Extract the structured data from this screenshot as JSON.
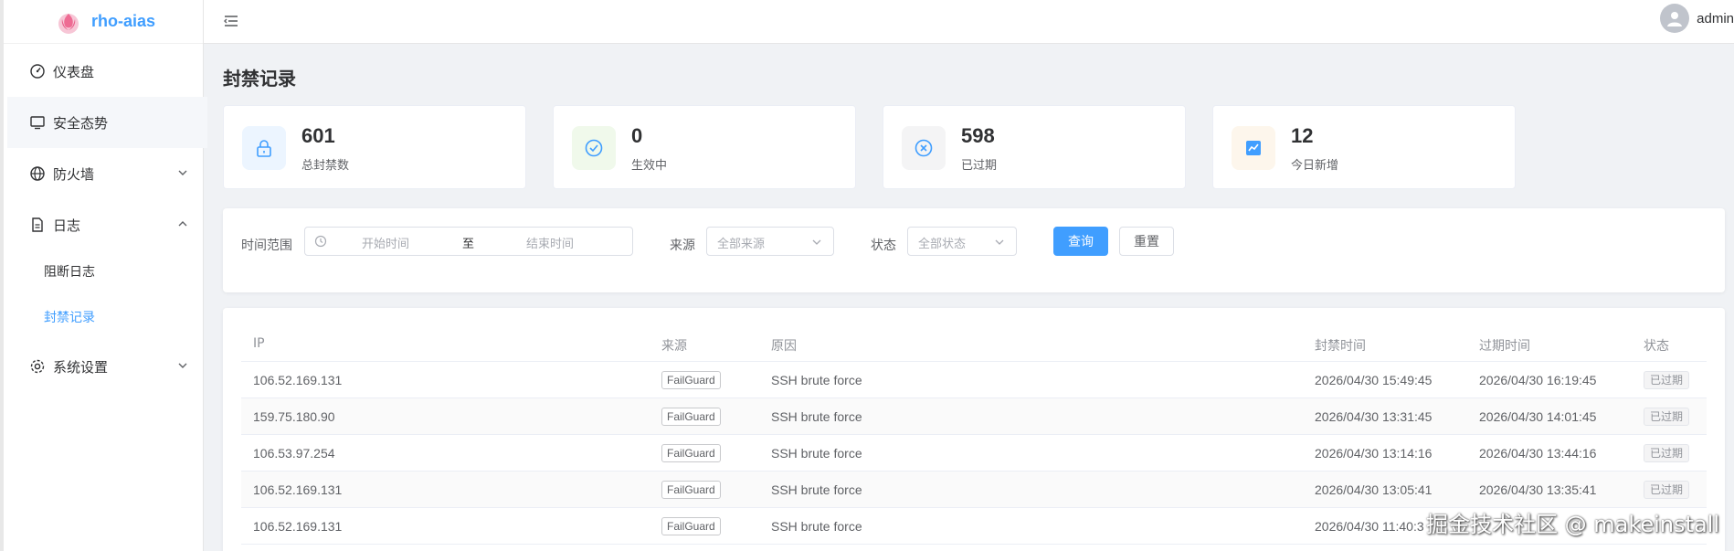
{
  "app": {
    "brand": "rho-aias"
  },
  "header": {
    "username": "admin"
  },
  "sidebar": {
    "items": [
      {
        "label": "仪表盘"
      },
      {
        "label": "安全态势"
      },
      {
        "label": "防火墙"
      },
      {
        "label": "日志",
        "children": [
          {
            "label": "阻断日志"
          },
          {
            "label": "封禁记录"
          }
        ]
      },
      {
        "label": "系统设置"
      }
    ]
  },
  "page": {
    "title": "封禁记录"
  },
  "stats": [
    {
      "value": "601",
      "label": "总封禁数",
      "icon": "lock-icon",
      "color": "#409eff"
    },
    {
      "value": "0",
      "label": "生效中",
      "icon": "check-circle-icon",
      "color": "#67c23a"
    },
    {
      "value": "598",
      "label": "已过期",
      "icon": "x-circle-icon",
      "color": "#409eff"
    },
    {
      "value": "12",
      "label": "今日新增",
      "icon": "trend-icon",
      "color": "#409eff"
    }
  ],
  "filters": {
    "time_label": "时间范围",
    "start_placeholder": "开始时间",
    "range_sep": "至",
    "end_placeholder": "结束时间",
    "source_label": "来源",
    "source_placeholder": "全部来源",
    "status_label": "状态",
    "status_placeholder": "全部状态",
    "query_button": "查询",
    "reset_button": "重置"
  },
  "table": {
    "columns": [
      "IP",
      "来源",
      "原因",
      "封禁时间",
      "过期时间",
      "状态"
    ],
    "rows": [
      {
        "ip": "106.52.169.131",
        "source": "FailGuard",
        "reason": "SSH brute force",
        "ban_time": "2026/04/30 15:49:45",
        "expire_time": "2026/04/30 16:19:45",
        "status": "已过期"
      },
      {
        "ip": "159.75.180.90",
        "source": "FailGuard",
        "reason": "SSH brute force",
        "ban_time": "2026/04/30 13:31:45",
        "expire_time": "2026/04/30 14:01:45",
        "status": "已过期"
      },
      {
        "ip": "106.53.97.254",
        "source": "FailGuard",
        "reason": "SSH brute force",
        "ban_time": "2026/04/30 13:14:16",
        "expire_time": "2026/04/30 13:44:16",
        "status": "已过期"
      },
      {
        "ip": "106.52.169.131",
        "source": "FailGuard",
        "reason": "SSH brute force",
        "ban_time": "2026/04/30 13:05:41",
        "expire_time": "2026/04/30 13:35:41",
        "status": "已过期"
      },
      {
        "ip": "106.52.169.131",
        "source": "FailGuard",
        "reason": "SSH brute force",
        "ban_time": "2026/04/30 11:40:3",
        "expire_time": "",
        "status": ""
      }
    ]
  },
  "watermark": "掘金技术社区 @ makeinstall"
}
